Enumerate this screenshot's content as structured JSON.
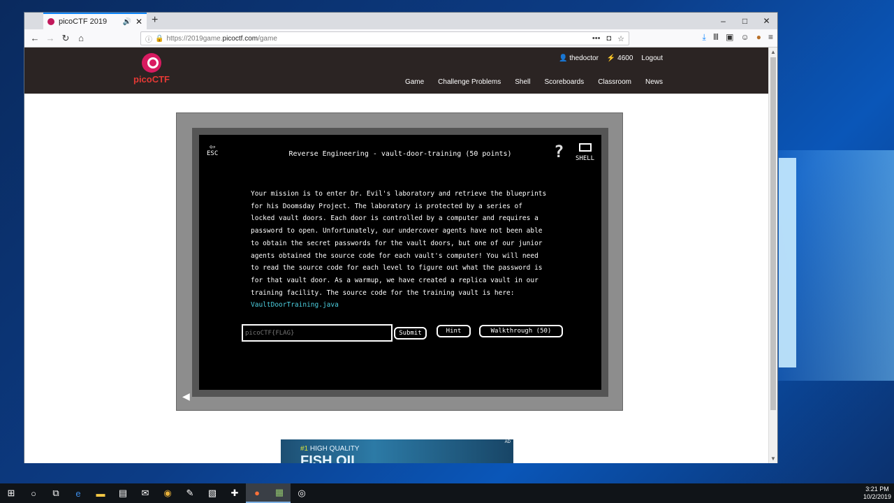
{
  "browser": {
    "tab_title": "picoCTF 2019",
    "url_prefix": "https://2019game.",
    "url_host": "picoctf.com",
    "url_path": "/game",
    "new_tab": "+",
    "win_min": "–",
    "win_max": "□",
    "win_close": "✕",
    "tab_close": "✕"
  },
  "site": {
    "logo_text": "picoCTF",
    "username": "thedoctor",
    "score": "4600",
    "logout": "Logout",
    "nav": [
      "Game",
      "Challenge Problems",
      "Shell",
      "Scoreboards",
      "Classroom",
      "News"
    ]
  },
  "game": {
    "esc_label": "ESC",
    "title": "Reverse Engineering - vault-door-training (50 points)",
    "help_label": "?",
    "shell_label": "SHELL",
    "description": "Your mission is to enter Dr. Evil's laboratory and retrieve the blueprints\nfor his Doomsday Project. The laboratory is protected by a series of\nlocked vault doors. Each door is controlled by a computer and requires a\npassword to open. Unfortunately, our undercover agents have not been able\nto obtain the secret passwords for the vault doors, but one of our junior\nagents obtained the source code for each vault's computer! You will need\nto read the source code for each level to figure out what the password is\nfor that vault door. As a warmup, we have created a replica vault in our\ntraining facility. The source code for the training vault is here:",
    "link_text": "VaultDoorTraining.java",
    "flag_placeholder": "picoCTF{FLAG}",
    "submit": "Submit",
    "hint": "Hint",
    "walkthrough": "Walkthrough (50)"
  },
  "ad": {
    "num": "#1",
    "line1": " HIGH QUALITY",
    "line2": "FISH OIL",
    "tag": "AD"
  },
  "taskbar": {
    "time": "3:21 PM",
    "date": "10/2/2019"
  },
  "colors": {
    "accent": "#0a84ff",
    "header_bg": "#2b2423",
    "logo": "#d81b60",
    "link": "#4dd0e1"
  }
}
